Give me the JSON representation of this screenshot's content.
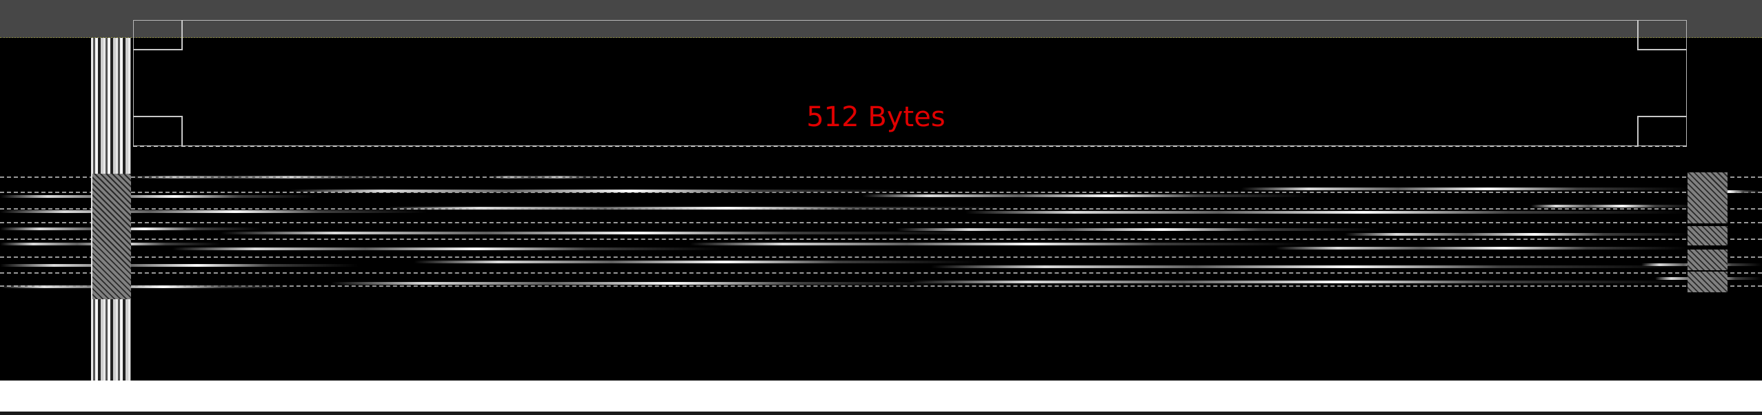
{
  "selection": {
    "size_label": "512 Bytes"
  },
  "colors": {
    "toolbar": "#474747",
    "canvas_background": "#000000",
    "label": "#e00000",
    "selection_border": "#b9b9b9"
  }
}
